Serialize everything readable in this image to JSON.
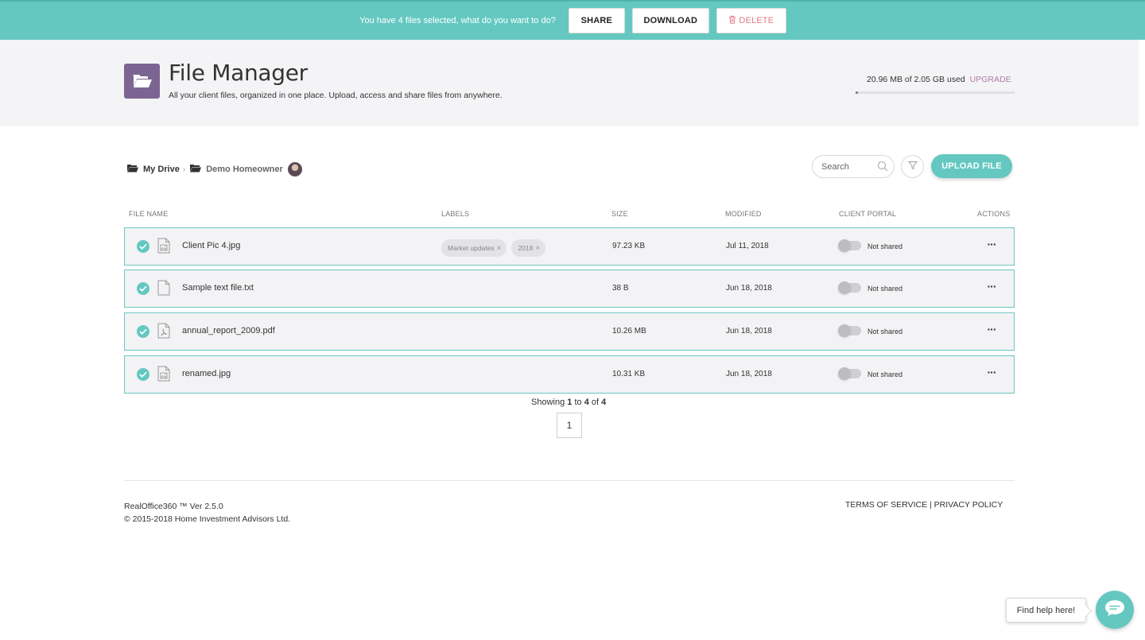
{
  "selection_bar": {
    "message": "You have 4 files selected, what do you want to do?",
    "share_label": "SHARE",
    "download_label": "DOWNLOAD",
    "delete_label": "DELETE"
  },
  "header": {
    "title": "File Manager",
    "subtitle": "All your client files, organized in one place. Upload, access and share files from anywhere.",
    "storage_text": "20.96 MB of 2.05 GB used",
    "upgrade_label": "UPGRADE",
    "storage_used_fraction": 0.01
  },
  "breadcrumb": {
    "root_label": "My Drive",
    "separator": "›",
    "current_label": "Demo Homeowner"
  },
  "search": {
    "placeholder": "Search"
  },
  "upload_label": "UPLOAD FILE",
  "table": {
    "headers": {
      "name": "FILE NAME",
      "labels": "LABELS",
      "size": "SIZE",
      "modified": "MODIFIED",
      "portal": "CLIENT PORTAL",
      "actions": "ACTIONS"
    },
    "rows": [
      {
        "name": "Client Pic 4.jpg",
        "icon": "image-file-icon",
        "labels": [
          "Market updates",
          "2018"
        ],
        "size": "97.23 KB",
        "modified": "Jul 11, 2018",
        "portal": "Not shared",
        "actions": "···"
      },
      {
        "name": "Sample text file.txt",
        "icon": "text-file-icon",
        "labels": [],
        "size": "38 B",
        "modified": "Jun 18, 2018",
        "portal": "Not shared",
        "actions": "···"
      },
      {
        "name": "annual_report_2009.pdf",
        "icon": "pdf-file-icon",
        "labels": [],
        "size": "10.26 MB",
        "modified": "Jun 18, 2018",
        "portal": "Not shared",
        "actions": "···"
      },
      {
        "name": "renamed.jpg",
        "icon": "image-file-icon",
        "labels": [],
        "size": "10.31 KB",
        "modified": "Jun 18, 2018",
        "portal": "Not shared",
        "actions": "···"
      }
    ]
  },
  "pagination": {
    "showing_prefix": "Showing",
    "from": "1",
    "to_word": "to",
    "to": "4",
    "of_word": "of",
    "total": "4",
    "page": "1"
  },
  "footer": {
    "version": "RealOffice360 ™ Ver 2.5.0",
    "copyright": "© 2015-2018 Home Investment Advisors Ltd.",
    "terms_label": "TERMS OF SERVICE",
    "separator": "|",
    "privacy_label": "PRIVACY POLICY"
  },
  "help": {
    "bubble_text": "Find help here!"
  },
  "colors": {
    "accent": "#64c8c1",
    "brand_purple": "#7c6592",
    "upgrade": "#b27aa8",
    "delete": "#e07c86"
  }
}
